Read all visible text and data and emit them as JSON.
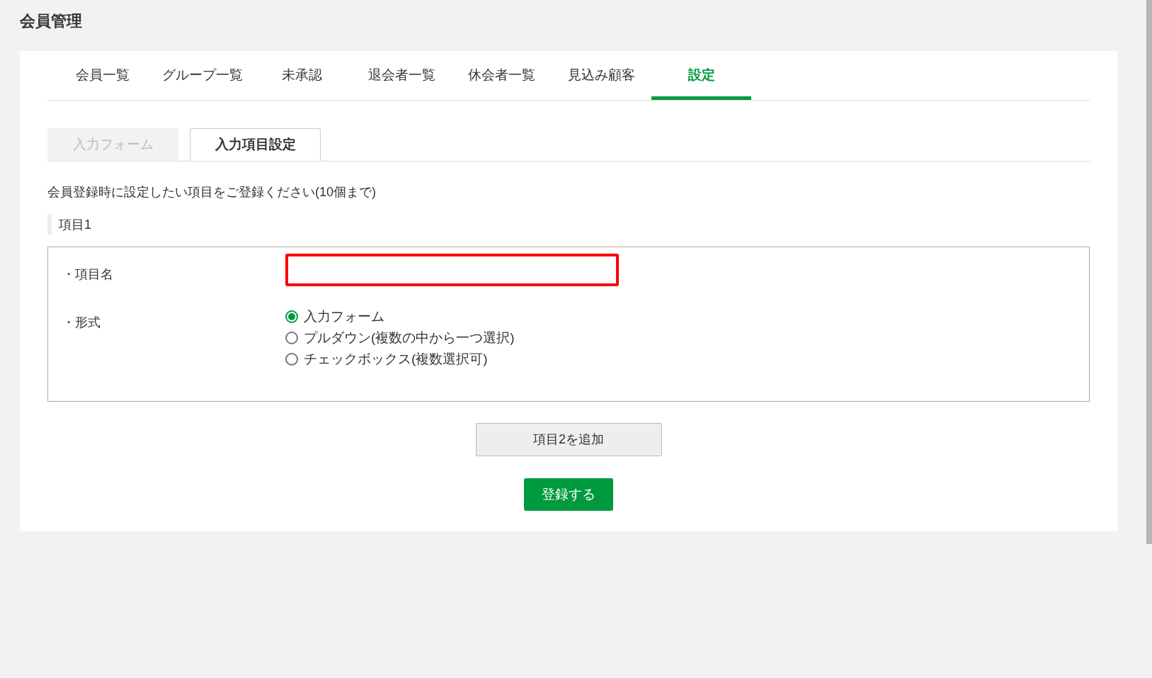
{
  "page_title": "会員管理",
  "tabs": [
    {
      "label": "会員一覧",
      "selected": false
    },
    {
      "label": "グループ一覧",
      "selected": false
    },
    {
      "label": "未承認",
      "selected": false
    },
    {
      "label": "退会者一覧",
      "selected": false
    },
    {
      "label": "休会者一覧",
      "selected": false
    },
    {
      "label": "見込み顧客",
      "selected": false
    },
    {
      "label": "設定",
      "selected": true
    }
  ],
  "sub_tabs": [
    {
      "label": "入力フォーム",
      "selected": false
    },
    {
      "label": "入力項目設定",
      "selected": true
    }
  ],
  "description": "会員登録時に設定したい項目をご登録ください(10個まで)",
  "section_label": "項目1",
  "item_name": {
    "label": "・項目名"
  },
  "format": {
    "label": "・形式",
    "options": [
      {
        "label": "入力フォーム",
        "selected": true
      },
      {
        "label": "プルダウン(複数の中から一つ選択)",
        "selected": false
      },
      {
        "label": "チェックボックス(複数選択可)",
        "selected": false
      }
    ]
  },
  "add_button": "項目2を追加",
  "submit_button": "登録する"
}
